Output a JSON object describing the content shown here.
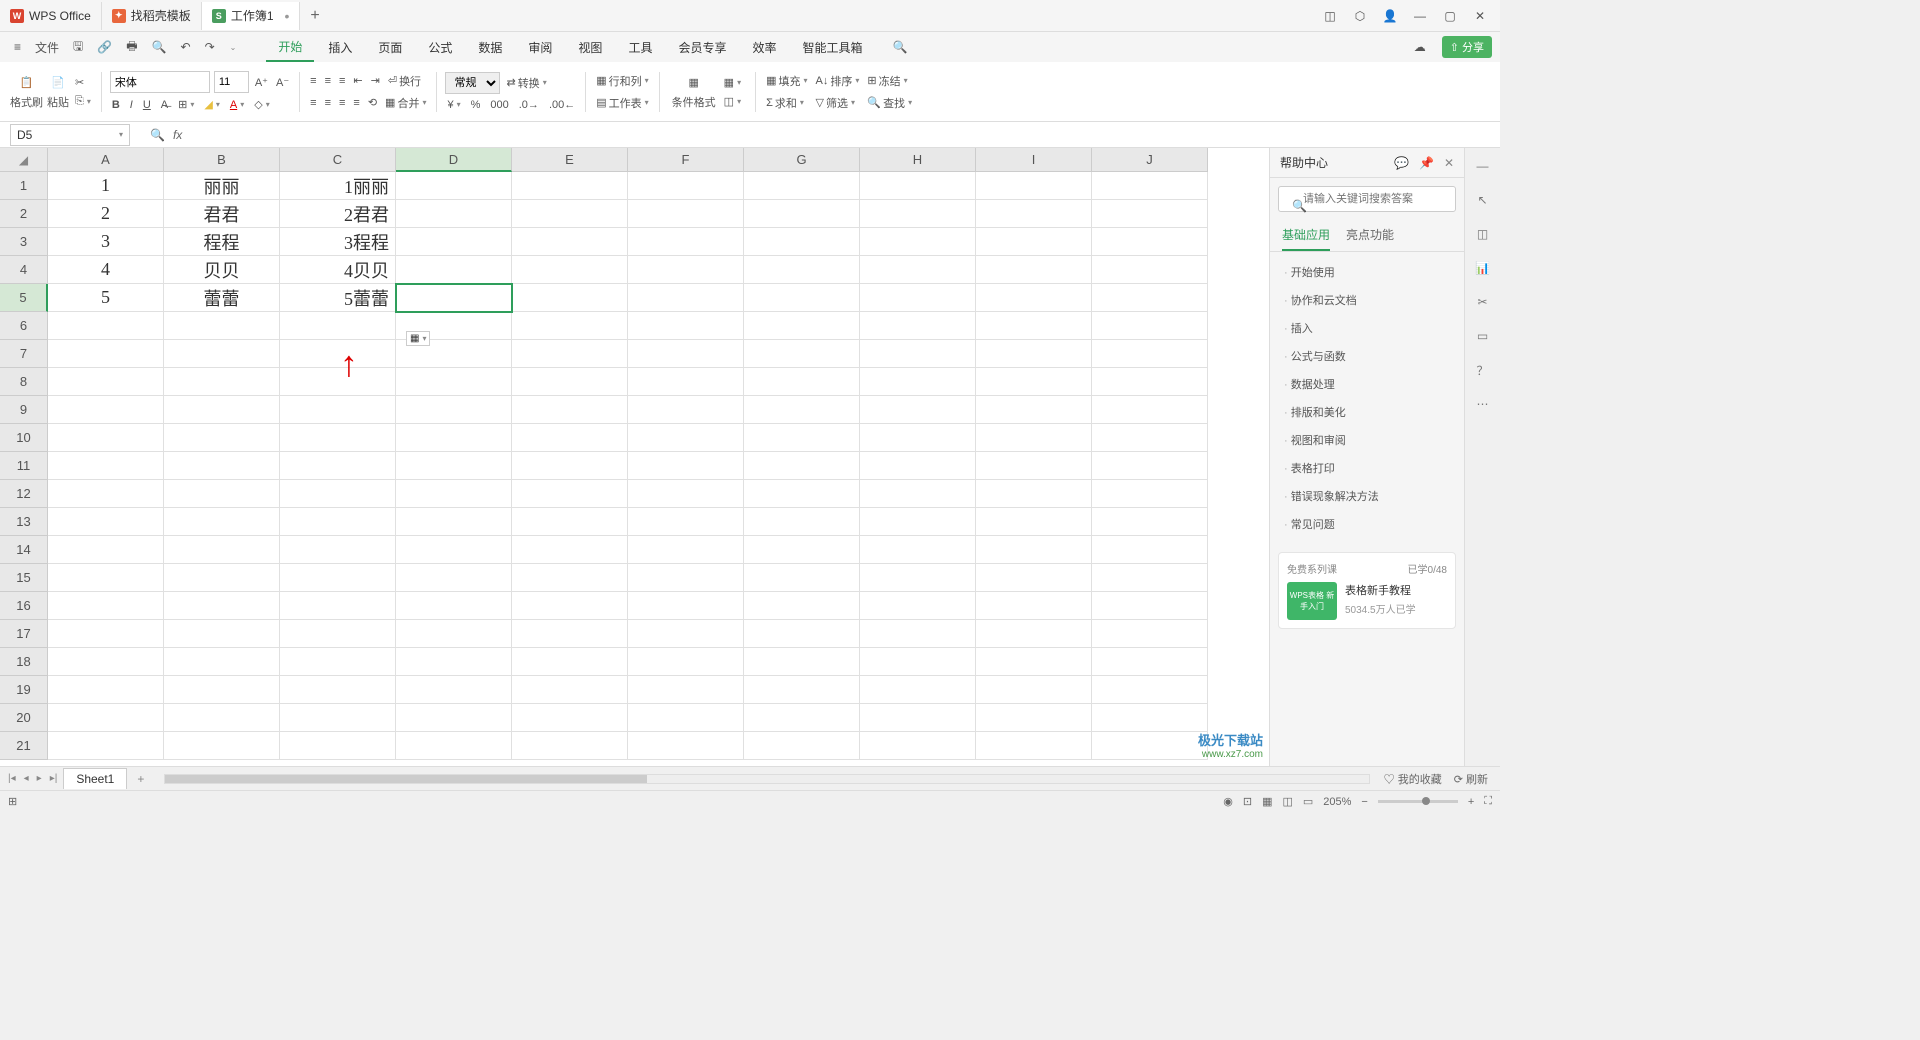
{
  "titlebar": {
    "tabs": [
      {
        "icon": "W",
        "label": "WPS Office"
      },
      {
        "icon": "D",
        "label": "找稻壳模板"
      },
      {
        "icon": "S",
        "label": "工作簿1"
      }
    ]
  },
  "menubar": {
    "file": "文件",
    "items": [
      "开始",
      "插入",
      "页面",
      "公式",
      "数据",
      "审阅",
      "视图",
      "工具",
      "会员专享",
      "效率",
      "智能工具箱"
    ],
    "active": "开始",
    "share": "分享"
  },
  "ribbon": {
    "format_brush": "格式刷",
    "paste": "粘贴",
    "font_name": "宋体",
    "font_size": "11",
    "number_format": "常规",
    "wrap": "换行",
    "convert": "转换",
    "merge": "合并",
    "rowcol": "行和列",
    "worksheet": "工作表",
    "cond_format": "条件格式",
    "fill": "填充",
    "sort": "排序",
    "freeze": "冻结",
    "sum": "求和",
    "filter": "筛选",
    "find": "查找"
  },
  "namebox": "D5",
  "columns": [
    "A",
    "B",
    "C",
    "D",
    "E",
    "F",
    "G",
    "H",
    "I",
    "J"
  ],
  "rows_count": 21,
  "selected_col": "D",
  "selected_row": 5,
  "cells": {
    "A1": "1",
    "B1": "丽丽",
    "C1": "1丽丽",
    "A2": "2",
    "B2": "君君",
    "C2": "2君君",
    "A3": "3",
    "B3": "程程",
    "C3": "3程程",
    "A4": "4",
    "B4": "贝贝",
    "C4": "4贝贝",
    "A5": "5",
    "B5": "蕾蕾",
    "C5": "5蕾蕾"
  },
  "help": {
    "title": "帮助中心",
    "search_ph": "请输入关键词搜索答案",
    "tabs": [
      "基础应用",
      "亮点功能"
    ],
    "items": [
      "开始使用",
      "协作和云文档",
      "插入",
      "公式与函数",
      "数据处理",
      "排版和美化",
      "视图和审阅",
      "表格打印",
      "错误现象解决方法",
      "常见问题"
    ],
    "course_cat": "免费系列课",
    "course_progress": "已学0/48",
    "course_thumb": "WPS表格\n新手入门",
    "course_title": "表格新手教程",
    "course_sub": "5034.5万人已学"
  },
  "sheet_tabs": {
    "name": "Sheet1",
    "fav": "我的收藏",
    "refresh": "刷新"
  },
  "statusbar": {
    "zoom": "205%"
  },
  "watermark": {
    "brand": "极光下载站",
    "url": "www.xz7.com"
  }
}
